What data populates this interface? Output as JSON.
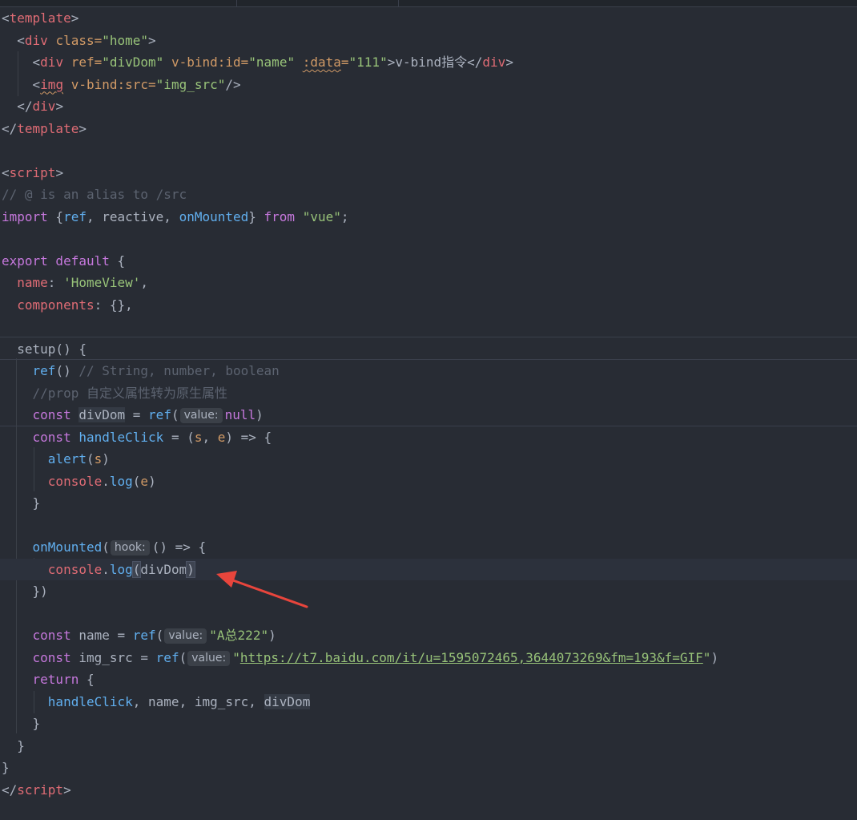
{
  "code": {
    "l1": {
      "a": "<",
      "b": "template",
      "c": ">"
    },
    "l2": {
      "a": "<",
      "b": "div",
      "c": " class=",
      "d": "\"home\"",
      "e": ">"
    },
    "l3": {
      "a": "<",
      "b": "div",
      "c": " ref=",
      "d": "\"divDom\"",
      "e": " v-bind:id=",
      "f": "\"name\"",
      "g": " ",
      "h": ":data",
      "i": "=",
      "j": "\"111\"",
      "k": ">v-bind指令</",
      "l": "div",
      "m": ">"
    },
    "l4": {
      "a": "<",
      "b": "img",
      "c": " v-bind:src=",
      "d": "\"img_src\"",
      "e": "/>"
    },
    "l5": {
      "a": "</",
      "b": "div",
      "c": ">"
    },
    "l6": {
      "a": "</",
      "b": "template",
      "c": ">"
    },
    "l8": {
      "a": "<",
      "b": "script",
      "c": ">"
    },
    "l9": {
      "a": "// @ is an alias to /src"
    },
    "l10": {
      "a": "import",
      "b": " {",
      "c": "ref",
      "d": ", reactive, ",
      "e": "onMounted",
      "f": "} ",
      "g": "from",
      "h": " ",
      "i": "\"vue\"",
      "j": ";"
    },
    "l12": {
      "a": "export default",
      "b": " {"
    },
    "l13": {
      "a": "name",
      "b": ": ",
      "c": "'HomeView'",
      "d": ","
    },
    "l14": {
      "a": "components",
      "b": ": {},"
    },
    "l16": {
      "a": "setup() {"
    },
    "l17": {
      "a": "ref",
      "b": "() ",
      "c": "// String, number, boolean"
    },
    "l18": {
      "a": "//prop 自定义属性转为原生属性"
    },
    "l19": {
      "a": "const",
      "b": " ",
      "c": "divDom",
      "d": " = ",
      "e": "ref",
      "f": "(",
      "hint": "value:",
      "g": "null",
      "h": ")"
    },
    "l20": {
      "a": "const",
      "b": " ",
      "c": "handleClick",
      "d": " = (",
      "e": "s",
      "f": ", ",
      "g": "e",
      "h": ") => {"
    },
    "l21": {
      "a": "alert",
      "b": "(",
      "c": "s",
      "d": ")"
    },
    "l22": {
      "a": "console",
      "b": ".",
      "c": "log",
      "d": "(",
      "e": "e",
      "f": ")"
    },
    "l23": {
      "a": "}"
    },
    "l25": {
      "a": "onMounted",
      "b": "(",
      "hint": "hook:",
      "c": "() => {"
    },
    "l26": {
      "a": "console",
      "b": ".",
      "c": "log",
      "d": "(",
      "e": "divDom",
      "f": ")"
    },
    "l27": {
      "a": "})"
    },
    "l29": {
      "a": "const",
      "b": " name = ",
      "c": "ref",
      "d": "(",
      "hint": "value:",
      "e": "\"A总222\"",
      "f": ")"
    },
    "l30": {
      "a": "const",
      "b": " img_src = ",
      "c": "ref",
      "d": "(",
      "hint": "value:",
      "e": "\"",
      "url": "https://t7.baidu.com/it/u=1595072465,3644073269&fm=193&f=GIF",
      "f": "\"",
      "g": ")"
    },
    "l31": {
      "a": "return",
      "b": " {"
    },
    "l32": {
      "a": "handleClick",
      "b": ", name, img_src, ",
      "c": "divDom"
    },
    "l33": {
      "a": "}"
    },
    "l34": {
      "a": "}"
    },
    "l35": {
      "a": "}"
    },
    "l36": {
      "a": "</",
      "b": "script",
      "c": ">"
    }
  },
  "colors": {
    "background": "#282c34",
    "tag": "#e06c75",
    "attribute": "#d19a66",
    "string": "#98c379",
    "keyword": "#c678dd",
    "function": "#61afef",
    "comment": "#5c6370",
    "annotation_arrow": "#e8453c"
  }
}
